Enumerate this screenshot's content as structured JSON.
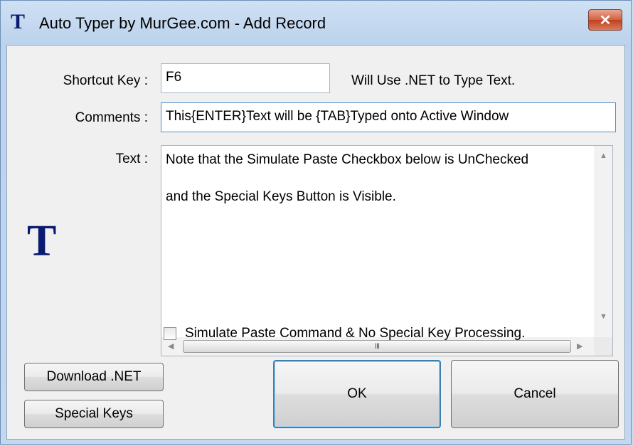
{
  "window": {
    "title": "Auto Typer by MurGee.com - Add Record",
    "close_glyph": "✕",
    "icon": "app-t-icon"
  },
  "form": {
    "shortcut_label": "Shortcut Key :",
    "shortcut_value": "F6",
    "shortcut_hint": "Will Use .NET to Type Text.",
    "comments_label": "Comments :",
    "comments_value": "This{ENTER}Text will be {TAB}Typed onto Active Window",
    "text_label": "Text :",
    "text_lines": [
      "Note that the Simulate Paste Checkbox below is UnChecked",
      "and the Special Keys Button is Visible."
    ],
    "logo_glyph": "T"
  },
  "scrollbar": {
    "left_arrow": "◀",
    "right_arrow": "▶",
    "up_arrow": "▲",
    "down_arrow": "▼",
    "thumb_grip": "III"
  },
  "checkbox": {
    "label": "Simulate Paste Command & No Special Key Processing.",
    "checked": false
  },
  "buttons": {
    "download_net": "Download .NET",
    "special_keys": "Special Keys",
    "ok": "OK",
    "cancel": "Cancel"
  },
  "colors": {
    "title_accent": "#0a1a6e",
    "close_button": "#c9472a",
    "default_button_border": "#3c7fb1"
  }
}
